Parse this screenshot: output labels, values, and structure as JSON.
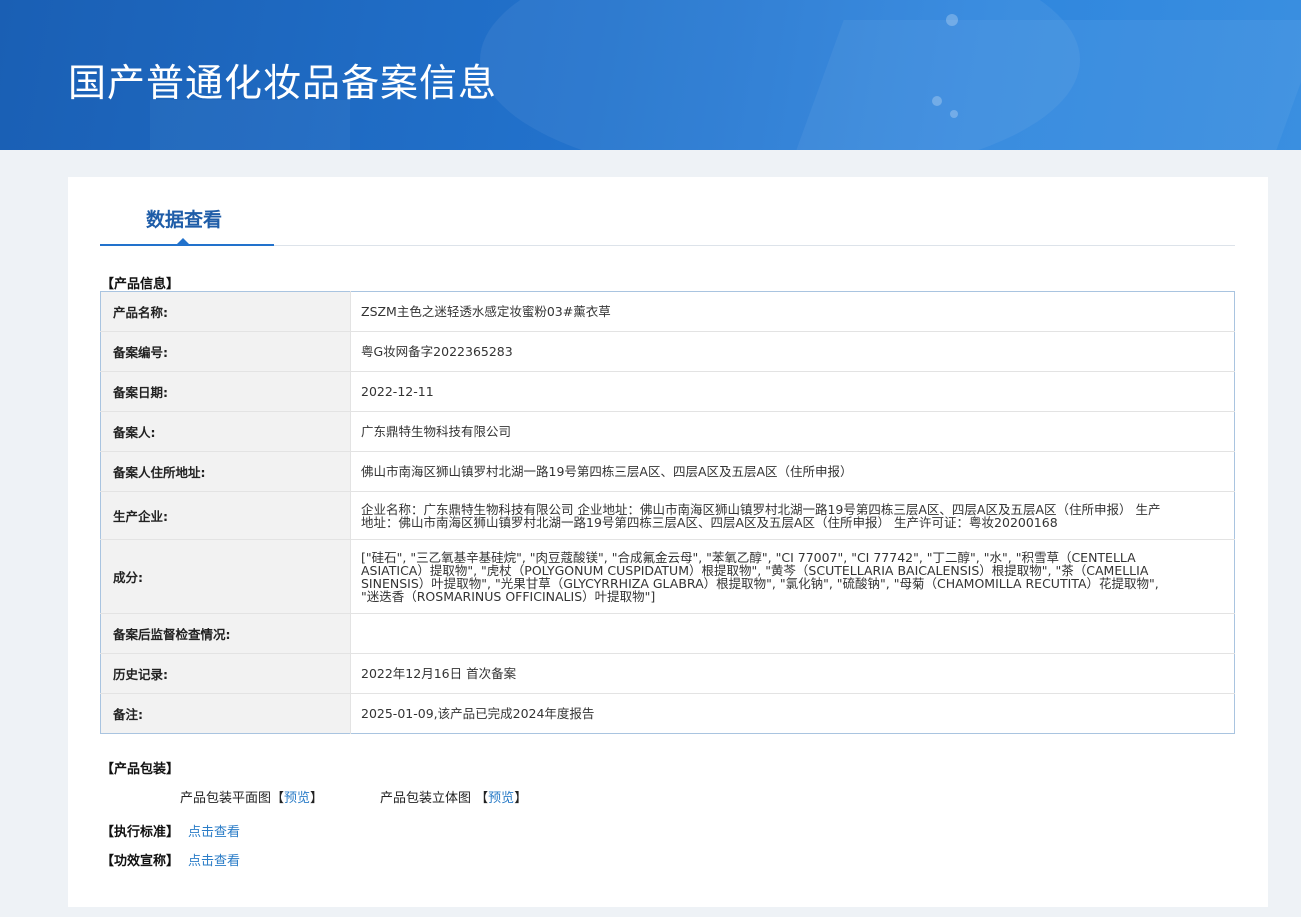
{
  "header": {
    "title": "国产普通化妆品备案信息"
  },
  "tabs": [
    {
      "label": "数据查看",
      "active": true
    }
  ],
  "product_info": {
    "section_title": "【产品信息】",
    "rows": [
      {
        "label": "产品名称:",
        "value": "ZSZM主色之迷轻透水感定妆蜜粉03#薰衣草"
      },
      {
        "label": "备案编号:",
        "value": "粤G妆网备字2022365283"
      },
      {
        "label": "备案日期:",
        "value": "2022-12-11"
      },
      {
        "label": "备案人:",
        "value": "广东鼎特生物科技有限公司"
      },
      {
        "label": "备案人住所地址:",
        "value": "佛山市南海区狮山镇罗村北湖一路19号第四栋三层A区、四层A区及五层A区（住所申报）"
      },
      {
        "label": "生产企业:",
        "value": "企业名称：广东鼎特生物科技有限公司 企业地址：佛山市南海区狮山镇罗村北湖一路19号第四栋三层A区、四层A区及五层A区（住所申报） 生产地址：佛山市南海区狮山镇罗村北湖一路19号第四栋三层A区、四层A区及五层A区（住所申报） 生产许可证：粤妆20200168"
      },
      {
        "label": "成分:",
        "value": "[\"硅石\", \"三乙氧基辛基硅烷\", \"肉豆蔻酸镁\", \"合成氟金云母\", \"苯氧乙醇\", \"CI 77007\", \"CI 77742\", \"丁二醇\", \"水\", \"积雪草（CENTELLA ASIATICA）提取物\", \"虎杖（POLYGONUM CUSPIDATUM）根提取物\", \"黄芩（SCUTELLARIA BAICALENSIS）根提取物\", \"茶（CAMELLIA SINENSIS）叶提取物\", \"光果甘草（GLYCYRRHIZA GLABRA）根提取物\", \"氯化钠\", \"硫酸钠\", \"母菊（CHAMOMILLA RECUTITA）花提取物\", \"迷迭香（ROSMARINUS OFFICINALIS）叶提取物\"]"
      },
      {
        "label": "备案后监督检查情况:",
        "value": ""
      },
      {
        "label": "历史记录:",
        "value": "2022年12月16日 首次备案"
      },
      {
        "label": "备注:",
        "value": "2025-01-09,该产品已完成2024年度报告"
      }
    ]
  },
  "packaging": {
    "section_title": "【产品包装】",
    "flat_label": "产品包装平面图",
    "solid_label": "产品包装立体图",
    "bracket_open": "【",
    "bracket_close": "】",
    "preview_link": "预览"
  },
  "standard": {
    "label": "【执行标准】",
    "link": "点击查看"
  },
  "efficacy": {
    "label": "【功效宣称】",
    "link": "点击查看"
  },
  "colors": {
    "banner": "#2272cc",
    "tab_text": "#1f5da8",
    "link": "#2a7cc7"
  }
}
